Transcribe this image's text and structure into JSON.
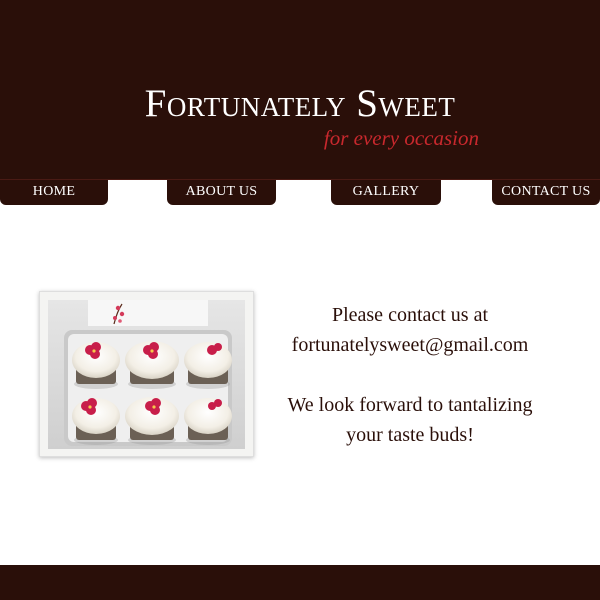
{
  "header": {
    "title": "Fortunately Sweet",
    "tagline": "for every occasion"
  },
  "nav": {
    "items": [
      {
        "label": "HOME"
      },
      {
        "label": "ABOUT US"
      },
      {
        "label": "GALLERY"
      },
      {
        "label": "CONTACT US"
      }
    ]
  },
  "main": {
    "photo": {
      "box_label": "Fortunately Sweet",
      "box_sublabel": "for every occasion"
    },
    "contact": {
      "line1": "Please contact us at",
      "email": "fortunatelysweet@gmail.com",
      "line3": "We look forward to tantalizing",
      "line4": "your taste buds!"
    }
  },
  "colors": {
    "brand_dark": "#2a0f09",
    "accent_red": "#c8282d",
    "background": "#ffffff"
  }
}
